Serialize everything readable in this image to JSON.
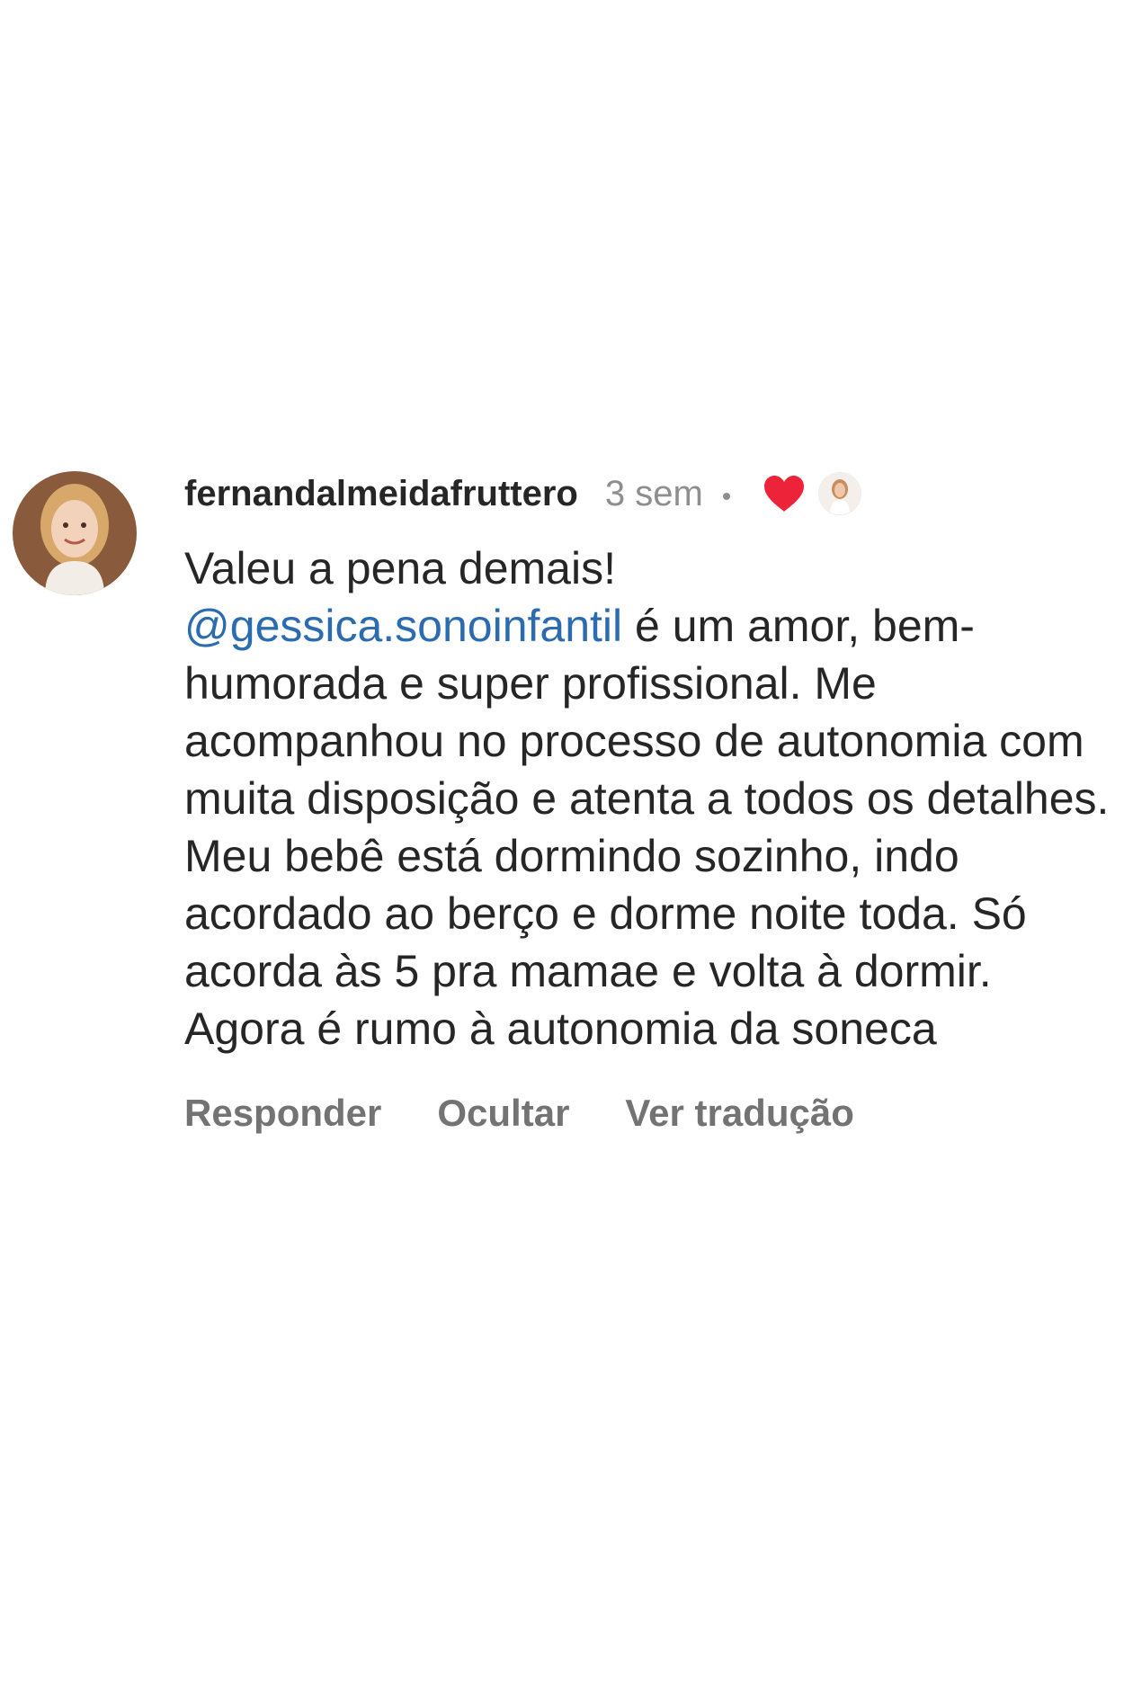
{
  "comment": {
    "username": "fernandalmeidafruttero",
    "time": "3 sem",
    "avatar_icon": "profile-photo",
    "liked_icon": "heart-icon",
    "liked_color": "#ed2439",
    "author_liked_avatar_icon": "profile-photo-mini",
    "text_before_mention": "Valeu a pena demais!",
    "mention": "@gessica.sonoinfantil",
    "mention_color": "#2b6cb0",
    "text_after_mention": " é um amor, bem-humorada e super profissional. Me acompanhou no processo de autonomia com muita disposição e atenta a todos os detalhes. Meu bebê está dormindo sozinho, indo acordado ao berço e dorme noite toda. Só acorda às 5 pra mamae e volta à dormir. Agora é rumo à autonomia da soneca",
    "actions": {
      "reply": "Responder",
      "hide": "Ocultar",
      "translate": "Ver tradução"
    }
  }
}
